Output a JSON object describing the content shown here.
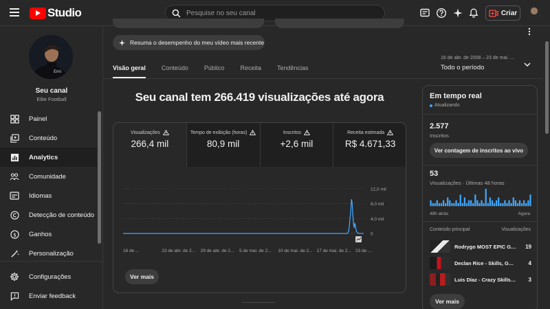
{
  "app": {
    "logo_text": "Studio",
    "search_placeholder": "Pesquise no seu canal",
    "create_label": "Criar"
  },
  "channel": {
    "name": "Seu canal",
    "subtitle": "Elite Football"
  },
  "sidebar": {
    "items": [
      {
        "label": "Painel",
        "icon": "dashboard-icon"
      },
      {
        "label": "Conteúdo",
        "icon": "content-icon"
      },
      {
        "label": "Analytics",
        "icon": "analytics-icon",
        "active": true
      },
      {
        "label": "Comunidade",
        "icon": "community-icon"
      },
      {
        "label": "Idiomas",
        "icon": "subtitles-icon"
      },
      {
        "label": "Detecção de conteúdo",
        "icon": "copyright-icon"
      },
      {
        "label": "Ganhos",
        "icon": "earn-icon"
      },
      {
        "label": "Personalização",
        "icon": "customization-icon"
      }
    ],
    "bottom_items": [
      {
        "label": "Configurações",
        "icon": "gear-icon"
      },
      {
        "label": "Enviar feedback",
        "icon": "feedback-icon"
      }
    ]
  },
  "summary_pill": "Resuma o desempenho do meu vídeo mais recente",
  "tabs": [
    "Visão geral",
    "Conteúdo",
    "Público",
    "Receita",
    "Tendências"
  ],
  "period": {
    "range": "16 de abr. de 2008 – 23 de mai. ...",
    "label": "Todo o período"
  },
  "headline": "Seu canal tem 266.419 visualizações até agora",
  "metrics": [
    {
      "label": "Visualizações",
      "value": "266,4 mil"
    },
    {
      "label": "Tempo de exibição (horas)",
      "value": "80,9 mil"
    },
    {
      "label": "Inscritos",
      "value": "+2,6 mil"
    },
    {
      "label": "Receita estimada",
      "value": "R$ 4.671,33"
    }
  ],
  "chart_data": {
    "type": "line",
    "x_tick_labels": [
      "16 de ...",
      "23 de abr. de 2...",
      "29 de abr. de 2...",
      "5 de mai. de 2...",
      "10 de mai. de 2...",
      "17 de mai. de 2...",
      "23 de ..."
    ],
    "y_tick_labels": [
      "12,0 mil",
      "8,0 mil",
      "4,0 mil",
      "0"
    ],
    "ylim": [
      0,
      12000
    ],
    "series": [
      {
        "values": [
          0,
          0,
          0,
          0,
          0,
          0,
          0,
          0,
          0,
          0,
          0,
          0,
          0,
          0,
          0,
          0,
          0,
          0,
          0,
          0,
          0,
          0,
          0,
          0,
          0,
          0,
          0,
          0,
          0,
          0,
          0,
          0,
          0,
          0,
          0,
          0,
          0,
          0,
          0,
          0,
          0,
          0,
          0,
          0,
          0,
          0,
          0,
          0,
          0,
          0,
          0,
          0,
          0,
          0,
          0,
          0,
          0,
          0,
          0,
          0,
          0,
          0,
          0,
          0,
          0,
          0,
          0,
          0,
          0,
          0,
          0,
          0,
          0,
          0,
          0,
          0,
          0,
          0,
          0,
          0,
          0,
          0,
          0,
          0,
          0,
          0,
          0,
          0,
          0,
          0,
          0,
          0,
          0,
          0,
          0,
          0,
          0,
          0,
          0,
          0,
          0,
          0,
          0,
          0,
          0,
          0,
          0,
          0,
          0,
          0,
          0,
          0,
          0,
          0,
          0,
          0,
          0,
          0,
          0,
          0,
          0,
          0,
          0,
          0,
          0,
          0,
          0,
          0,
          0,
          0,
          0,
          0,
          0,
          0,
          0,
          0,
          0,
          0,
          0,
          0,
          0,
          0,
          0,
          0,
          0,
          0,
          0,
          0,
          0,
          0,
          0,
          0,
          0,
          0,
          0,
          0,
          0,
          0,
          0,
          0,
          0,
          0,
          0,
          0,
          0,
          0,
          0,
          0,
          0,
          0,
          0,
          0,
          0,
          0,
          0,
          0,
          0,
          0,
          0,
          0,
          0,
          0,
          0,
          0,
          0,
          0,
          0,
          0,
          0,
          0,
          0,
          0,
          0,
          0,
          0,
          0,
          0,
          0,
          0,
          0,
          0,
          0,
          0,
          0,
          0,
          0,
          0,
          0,
          0,
          0,
          0,
          0,
          0,
          0,
          0,
          0,
          0,
          0,
          0,
          0,
          0,
          0,
          0,
          0,
          0,
          0,
          0,
          0,
          0,
          0,
          0,
          0,
          0,
          0,
          0,
          0,
          0,
          0,
          0,
          0,
          0,
          0,
          0,
          0,
          0,
          0,
          0,
          0,
          0,
          0,
          0,
          0,
          0,
          0,
          0,
          0,
          0,
          0,
          0,
          0,
          0,
          0,
          0,
          0,
          0,
          0,
          0,
          0,
          0,
          0,
          0,
          0,
          0,
          0,
          0,
          0,
          0,
          0,
          0,
          0,
          0,
          0,
          0,
          0,
          0,
          0,
          0,
          0,
          0,
          0,
          0,
          0,
          0,
          0,
          0,
          0,
          0,
          0,
          0,
          0,
          0,
          0,
          0,
          0,
          0,
          0,
          0,
          0,
          0,
          0,
          0,
          0,
          0,
          0,
          0,
          0,
          0,
          0,
          0,
          0,
          0,
          0,
          0,
          0,
          0,
          0,
          0,
          0,
          0,
          0,
          0,
          400,
          600,
          2200,
          4300,
          6000,
          9200,
          8200,
          5100,
          2600,
          1500,
          2800,
          1900,
          800,
          400,
          200,
          100,
          0,
          0,
          0,
          0,
          0,
          0,
          0,
          0
        ]
      }
    ],
    "color": "#3ea6ff"
  },
  "ver_mais": "Ver mais",
  "realtime": {
    "title": "Em tempo real",
    "status": "Atualizando",
    "subscribers": "2.577",
    "subscribers_label": "Inscritos",
    "subscribers_button": "Ver contagem de inscritos ao vivo",
    "views": "53",
    "views_label": "Visualizações · Últimas 48 horas",
    "bars": [
      2,
      1,
      1,
      2,
      1,
      1,
      2,
      1,
      3,
      2,
      1,
      1,
      2,
      1,
      4,
      1,
      3,
      1,
      2,
      2,
      1,
      4,
      2,
      1,
      2,
      1,
      6,
      1,
      3,
      2,
      1,
      2,
      3,
      1,
      1,
      2,
      1,
      2,
      1,
      3,
      2,
      1,
      2,
      1,
      2,
      1,
      2,
      4
    ],
    "bars_xlabel_left": "48h atrás",
    "bars_xlabel_right": "Agora",
    "top_content_label": "Conteúdo principal",
    "views_col_label": "Visualizações",
    "videos": [
      {
        "title": "Rodrygo MOST EPIC Go...",
        "views": "19"
      },
      {
        "title": "Declan Rice - Skills, Goal...",
        "views": "4"
      },
      {
        "title": "Luis Díaz - Crazy Skills, A...",
        "views": "3"
      }
    ],
    "more_button": "Ver mais"
  }
}
